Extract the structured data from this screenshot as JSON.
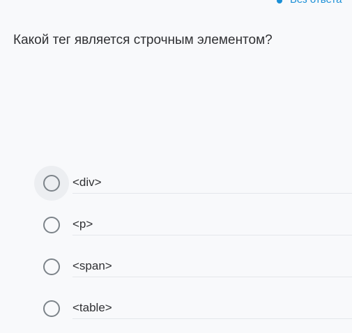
{
  "status": {
    "label": "Без ответа",
    "color": "#1b8fd6"
  },
  "question": {
    "text": "Какой тег является строчным элементом?"
  },
  "options": [
    {
      "label": "<div>",
      "selected": false,
      "focused": true
    },
    {
      "label": "<p>",
      "selected": false,
      "focused": false
    },
    {
      "label": "<span>",
      "selected": false,
      "focused": false
    },
    {
      "label": "<table>",
      "selected": false,
      "focused": false
    }
  ]
}
